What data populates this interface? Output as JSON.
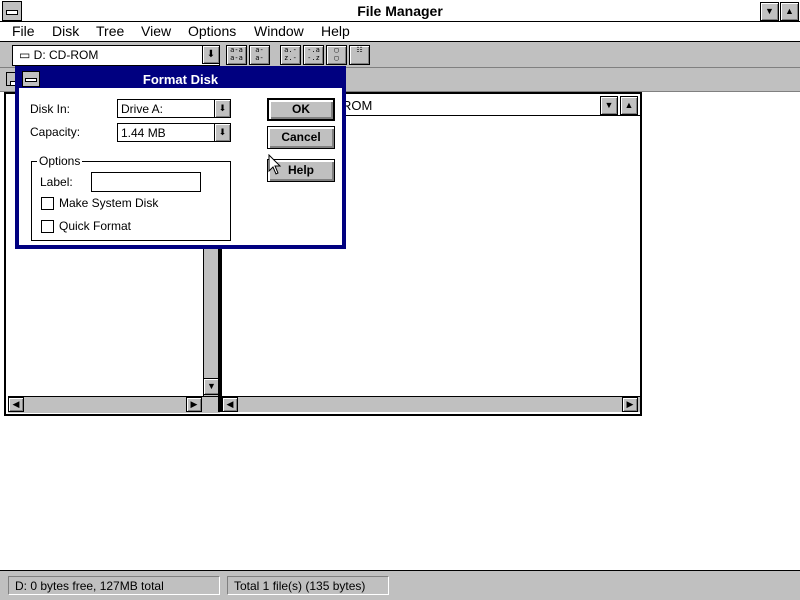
{
  "app": {
    "title": "File Manager",
    "menu": [
      {
        "label": "File"
      },
      {
        "label": "Disk"
      },
      {
        "label": "Tree"
      },
      {
        "label": "View"
      },
      {
        "label": "Options"
      },
      {
        "label": "Window"
      },
      {
        "label": "Help"
      }
    ]
  },
  "toolbar": {
    "drive_selected": "D: CD-ROM",
    "buttons": [
      {
        "icon": "connect-drive-icon"
      },
      {
        "icon": "disconnect-drive-icon"
      },
      {
        "icon": "sort-by-name-icon"
      },
      {
        "icon": "sort-by-type-icon"
      },
      {
        "icon": "new-window-icon"
      },
      {
        "icon": "view-details-icon"
      }
    ]
  },
  "child_window": {
    "path_text": "ROM"
  },
  "dialog": {
    "title": "Format Disk",
    "disk_in_label": "Disk In:",
    "disk_in_value": "Drive A:",
    "capacity_label": "Capacity:",
    "capacity_value": "1.44 MB",
    "options_caption": "Options",
    "label_field_label": "Label:",
    "label_field_value": "",
    "make_system_disk_label": "Make System Disk",
    "make_system_disk_checked": false,
    "quick_format_label": "Quick Format",
    "quick_format_checked": false,
    "ok_label": "OK",
    "cancel_label": "Cancel",
    "help_label": "Help"
  },
  "status": {
    "left": "D: 0 bytes free, 127MB total",
    "right": "Total 1 file(s) (135 bytes)"
  }
}
